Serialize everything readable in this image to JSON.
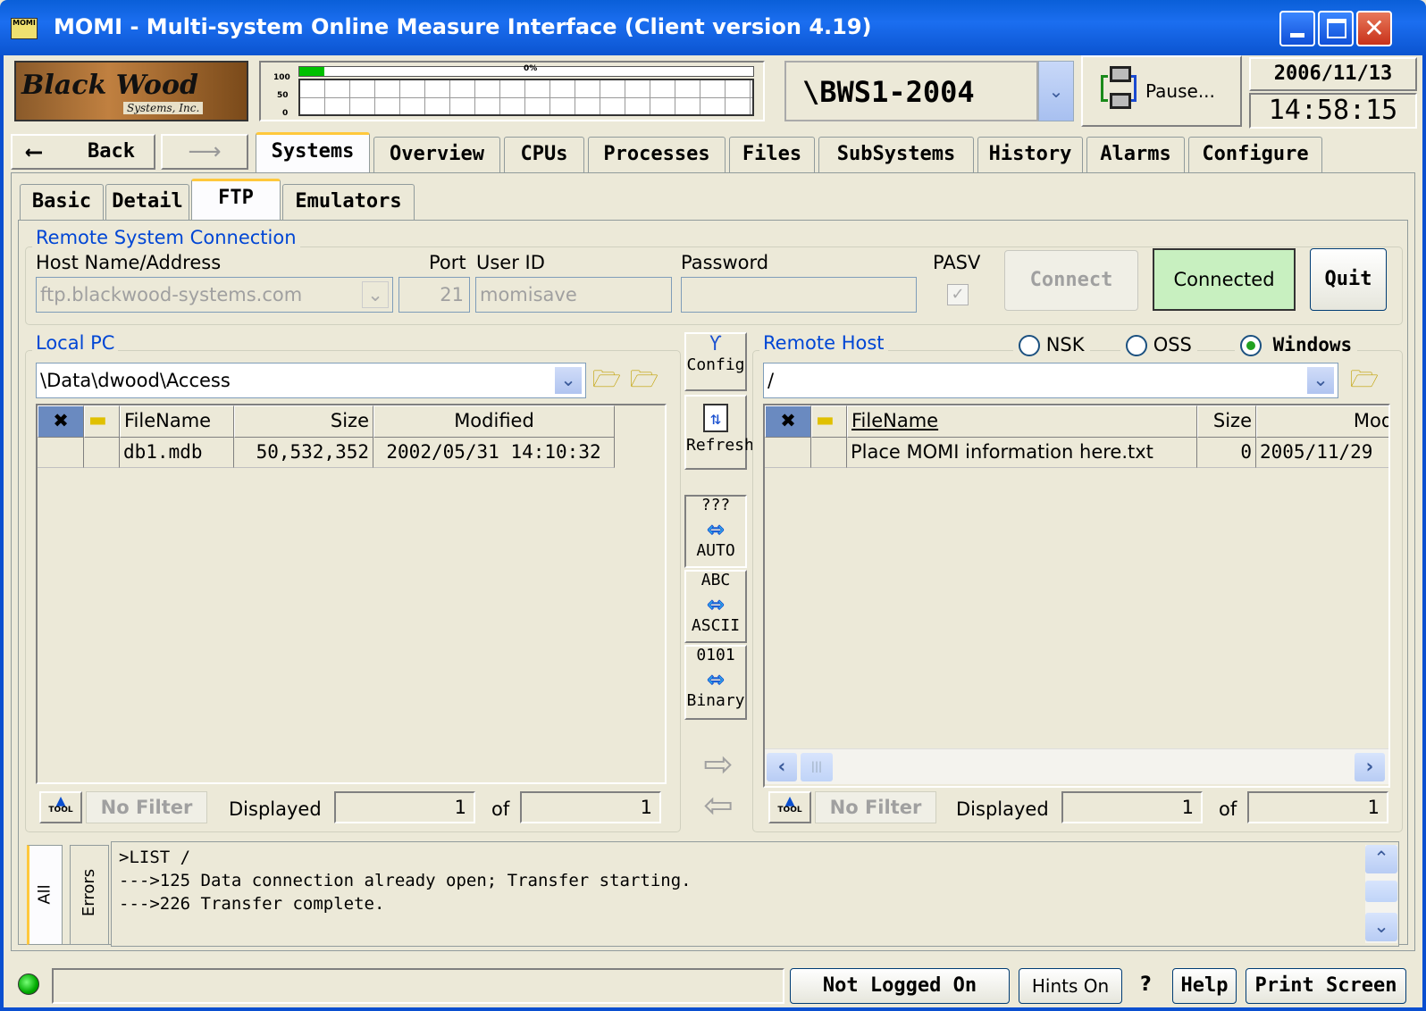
{
  "window": {
    "title": "MOMI - Multi-system Online Measure Interface (Client version 4.19)",
    "icon": "MOMI"
  },
  "logo": {
    "line1": "Black Wood",
    "line2": "Systems, Inc."
  },
  "cpu_meter": {
    "axis_100": "100",
    "axis_50": "50",
    "axis_0": "0",
    "pct_label": "0%"
  },
  "system": {
    "name": "\\BWS1-2004",
    "pause_label": "Pause...",
    "date": "2006/11/13",
    "time": "14:58:15"
  },
  "nav": {
    "back": "Back",
    "tabs": [
      "Systems",
      "Overview",
      "CPUs",
      "Processes",
      "Files",
      "SubSystems",
      "History",
      "Alarms",
      "Configure"
    ]
  },
  "subtabs": [
    "Basic",
    "Detail",
    "FTP",
    "Emulators"
  ],
  "remote_conn": {
    "legend": "Remote System Connection",
    "host_label": "Host Name/Address",
    "port_label": "Port",
    "user_label": "User ID",
    "password_label": "Password",
    "pasv_label": "PASV",
    "host": "ftp.blackwood-systems.com",
    "port": "21",
    "user": "momisave",
    "password": "",
    "pasv": true,
    "connect": "Connect",
    "status": "Connected",
    "quit": "Quit"
  },
  "local": {
    "legend": "Local PC",
    "path": "\\Data\\dwood\\Access",
    "headers": [
      "FileName",
      "Size",
      "Modified"
    ],
    "rows": [
      {
        "name": "db1.mdb",
        "size": "50,532,352",
        "modified": "2002/05/31 14:10:32"
      }
    ],
    "filter": "No Filter",
    "tool": "TOOL",
    "displayed_label": "Displayed",
    "displayed": "1",
    "of_label": "of",
    "total": "1"
  },
  "middle": {
    "config": "Config",
    "refresh": "Refresh",
    "auto_top": "???",
    "auto": "AUTO",
    "ascii_top": "ABC",
    "ascii": "ASCII",
    "binary_top": "0101",
    "binary": "Binary"
  },
  "remote": {
    "legend": "Remote Host",
    "os_options": [
      "NSK",
      "OSS",
      "Windows"
    ],
    "os_selected": "Windows",
    "path": "/",
    "headers": [
      "FileName",
      "Size",
      "Modi"
    ],
    "rows": [
      {
        "name": "Place MOMI information here.txt",
        "size": "0",
        "modified": "2005/11/29"
      }
    ],
    "filter": "No Filter",
    "tool": "TOOL",
    "displayed_label": "Displayed",
    "displayed": "1",
    "of_label": "of",
    "total": "1"
  },
  "log": {
    "tabs": [
      "All",
      "Errors"
    ],
    "lines": [
      ">LIST /",
      "--->125 Data connection already open; Transfer starting.",
      "--->226 Transfer complete."
    ]
  },
  "statusbar": {
    "login": "Not Logged On",
    "hints": "Hints On",
    "question": "?",
    "help": "Help",
    "print": "Print Screen"
  },
  "colors": {
    "titlebar": "#0a5fd8",
    "accent_blue": "#0046d5",
    "connected_bg": "#c8f0c0",
    "transfer_arrow": "#2ec5f5"
  }
}
